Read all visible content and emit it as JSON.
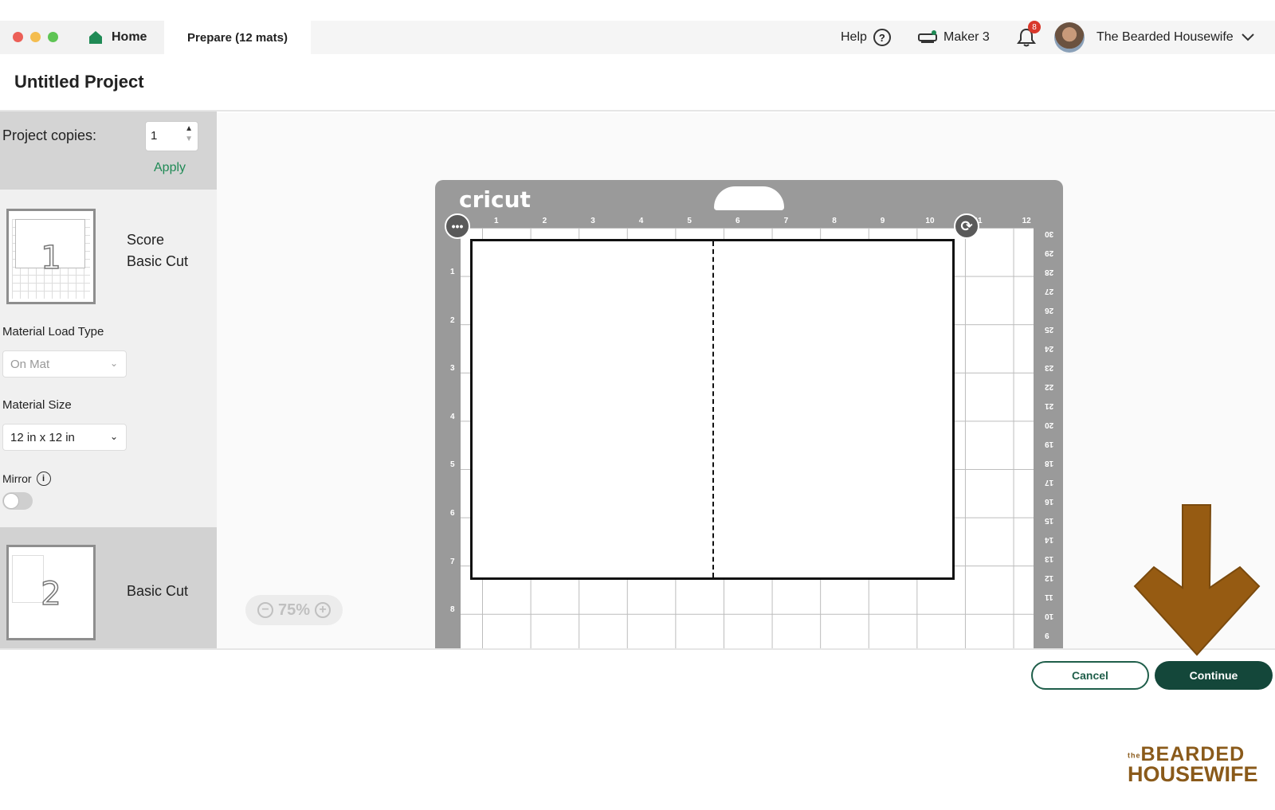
{
  "window": {
    "controls": [
      "close",
      "minimize",
      "zoom"
    ]
  },
  "tabs": {
    "home": "Home",
    "prepare": "Prepare (12 mats)"
  },
  "header": {
    "help": "Help",
    "help_symbol": "?",
    "machine": "Maker 3",
    "notifications_count": "8",
    "user_name": "The Bearded Housewife"
  },
  "project": {
    "title": "Untitled Project"
  },
  "sidebar": {
    "copies_label": "Project copies:",
    "copies_value": "1",
    "apply_label": "Apply",
    "mats": [
      {
        "number": "1",
        "label_line1": "Score",
        "label_line2": "Basic Cut"
      },
      {
        "number": "2",
        "label_line1": "Basic Cut"
      }
    ],
    "material_load_type_label": "Material Load Type",
    "material_load_type_value": "On Mat",
    "material_size_label": "Material Size",
    "material_size_value": "12 in x 12 in",
    "mirror_label": "Mirror",
    "mirror_on": false
  },
  "canvas": {
    "zoom_level": "75%",
    "mat_brand": "cricut",
    "top_ruler": [
      "1",
      "2",
      "3",
      "4",
      "5",
      "6",
      "7",
      "8",
      "9",
      "10",
      "11",
      "12"
    ],
    "left_ruler": [
      "1",
      "2",
      "3",
      "4",
      "5",
      "6",
      "7",
      "8"
    ],
    "right_ruler": [
      "30",
      "29",
      "28",
      "27",
      "26",
      "25",
      "24",
      "23",
      "22",
      "21",
      "20",
      "19",
      "18",
      "17",
      "16",
      "15",
      "14",
      "13",
      "12",
      "11",
      "10",
      "9"
    ]
  },
  "footer": {
    "cancel": "Cancel",
    "continue": "Continue"
  },
  "watermark": {
    "line_small": "the",
    "line1": "BEARDED",
    "line2": "HOUSEWIFE"
  },
  "colors": {
    "accent_green": "#1f8a55",
    "continue_bg": "#14473a",
    "arrow": "#965b12",
    "notification_badge": "#d9382b"
  }
}
